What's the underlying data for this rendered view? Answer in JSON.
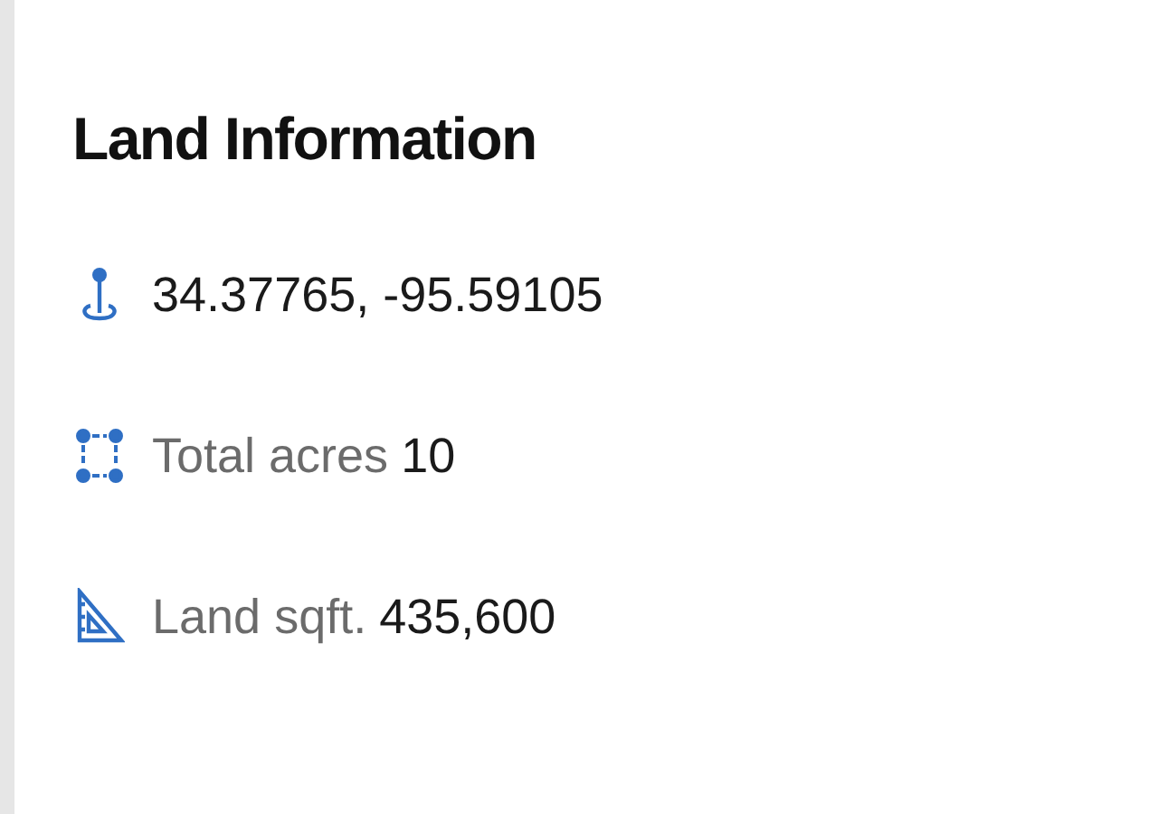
{
  "section": {
    "title": "Land Information",
    "items": [
      {
        "kind": "location",
        "value": "34.37765, -95.59105"
      },
      {
        "kind": "area",
        "label": "Total acres",
        "value": "10"
      },
      {
        "kind": "sqft",
        "label": "Land sqft.",
        "value": "435,600"
      }
    ]
  }
}
